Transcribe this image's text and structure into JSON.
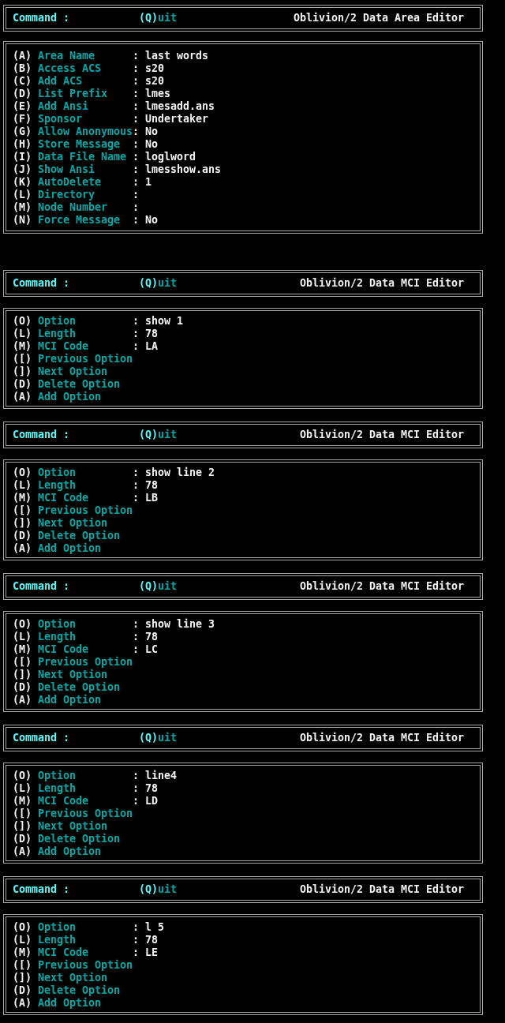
{
  "area_editor": {
    "header": {
      "command_label": "Command :",
      "quit": {
        "key": "(Q)",
        "rest": "uit"
      },
      "title": "Oblivion/2 Data Area Editor"
    },
    "fields": [
      {
        "key": "(A)",
        "label": "Area Name",
        "separator": ":",
        "value": "last words"
      },
      {
        "key": "(B)",
        "label": "Access ACS",
        "separator": ":",
        "value": "s20"
      },
      {
        "key": "(C)",
        "label": "Add ACS",
        "separator": ":",
        "value": "s20"
      },
      {
        "key": "(D)",
        "label": "List Prefix",
        "separator": ":",
        "value": "lmes"
      },
      {
        "key": "(E)",
        "label": "Add Ansi",
        "separator": ":",
        "value": "lmesadd.ans"
      },
      {
        "key": "(F)",
        "label": "Sponsor",
        "separator": ":",
        "value": "Undertaker"
      },
      {
        "key": "(G)",
        "label": "Allow Anonymous",
        "separator": ":",
        "value": "No"
      },
      {
        "key": "(H)",
        "label": "Store Message",
        "separator": ":",
        "value": "No"
      },
      {
        "key": "(I)",
        "label": "Data File Name",
        "separator": ":",
        "value": "loglword"
      },
      {
        "key": "(J)",
        "label": "Show Ansi",
        "separator": ":",
        "value": "lmesshow.ans"
      },
      {
        "key": "(K)",
        "label": "AutoDelete",
        "separator": ":",
        "value": "1"
      },
      {
        "key": "(L)",
        "label": "Directory",
        "separator": ":"
      },
      {
        "key": "(M)",
        "label": "Node Number",
        "separator": ":"
      },
      {
        "key": "(N)",
        "label": "Force Message",
        "separator": ":",
        "value": "No"
      }
    ]
  },
  "mci_editors": [
    {
      "header": {
        "command_label": "Command :",
        "quit": {
          "key": "(Q)",
          "rest": "uit"
        },
        "title": "Oblivion/2 Data MCI Editor"
      },
      "fields": [
        {
          "key": "(O)",
          "label": "Option",
          "separator": ":",
          "value": "show 1"
        },
        {
          "key": "(L)",
          "label": "Length",
          "separator": ":",
          "value": "78"
        },
        {
          "key": "(M)",
          "label": "MCI Code",
          "separator": ":",
          "value": "LA"
        },
        {
          "key": "([)",
          "label": "Previous Option"
        },
        {
          "key": "(])",
          "label": "Next Option"
        },
        {
          "key": "(D)",
          "label": "Delete Option"
        },
        {
          "key": "(A)",
          "label": "Add Option"
        }
      ]
    },
    {
      "header": {
        "command_label": "Command :",
        "quit": {
          "key": "(Q)",
          "rest": "uit"
        },
        "title": "Oblivion/2 Data MCI Editor"
      },
      "fields": [
        {
          "key": "(O)",
          "label": "Option",
          "separator": ":",
          "value": "show line 2"
        },
        {
          "key": "(L)",
          "label": "Length",
          "separator": ":",
          "value": "78"
        },
        {
          "key": "(M)",
          "label": "MCI Code",
          "separator": ":",
          "value": "LB"
        },
        {
          "key": "([)",
          "label": "Previous Option"
        },
        {
          "key": "(])",
          "label": "Next Option"
        },
        {
          "key": "(D)",
          "label": "Delete Option"
        },
        {
          "key": "(A)",
          "label": "Add Option"
        }
      ]
    },
    {
      "header": {
        "command_label": "Command :",
        "quit": {
          "key": "(Q)",
          "rest": "uit"
        },
        "title": "Oblivion/2 Data MCI Editor"
      },
      "fields": [
        {
          "key": "(O)",
          "label": "Option",
          "separator": ":",
          "value": "show line 3"
        },
        {
          "key": "(L)",
          "label": "Length",
          "separator": ":",
          "value": "78"
        },
        {
          "key": "(M)",
          "label": "MCI Code",
          "separator": ":",
          "value": "LC"
        },
        {
          "key": "([)",
          "label": "Previous Option"
        },
        {
          "key": "(])",
          "label": "Next Option"
        },
        {
          "key": "(D)",
          "label": "Delete Option"
        },
        {
          "key": "(A)",
          "label": "Add Option"
        }
      ]
    },
    {
      "header": {
        "command_label": "Command :",
        "quit": {
          "key": "(Q)",
          "rest": "uit"
        },
        "title": "Oblivion/2 Data MCI Editor"
      },
      "fields": [
        {
          "key": "(O)",
          "label": "Option",
          "separator": ":",
          "value": "line4"
        },
        {
          "key": "(L)",
          "label": "Length",
          "separator": ":",
          "value": "78"
        },
        {
          "key": "(M)",
          "label": "MCI Code",
          "separator": ":",
          "value": "LD"
        },
        {
          "key": "([)",
          "label": "Previous Option"
        },
        {
          "key": "(])",
          "label": "Next Option"
        },
        {
          "key": "(D)",
          "label": "Delete Option"
        },
        {
          "key": "(A)",
          "label": "Add Option"
        }
      ]
    },
    {
      "header": {
        "command_label": "Command :",
        "quit": {
          "key": "(Q)",
          "rest": "uit"
        },
        "title": "Oblivion/2 Data MCI Editor"
      },
      "fields": [
        {
          "key": "(O)",
          "label": "Option",
          "separator": ":",
          "value": "l 5"
        },
        {
          "key": "(L)",
          "label": "Length",
          "separator": ":",
          "value": "78"
        },
        {
          "key": "(M)",
          "label": "MCI Code",
          "separator": ":",
          "value": "LE"
        },
        {
          "key": "([)",
          "label": "Previous Option"
        },
        {
          "key": "(])",
          "label": "Next Option"
        },
        {
          "key": "(D)",
          "label": "Delete Option"
        },
        {
          "key": "(A)",
          "label": "Add Option"
        }
      ]
    }
  ]
}
